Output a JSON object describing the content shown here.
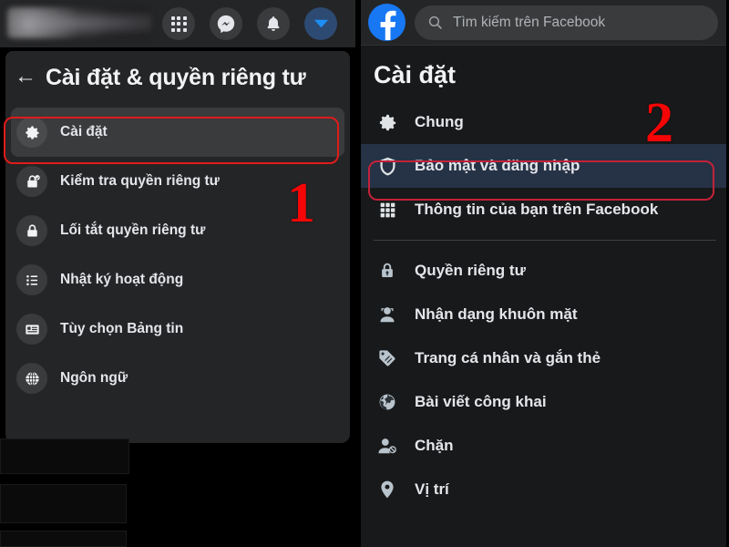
{
  "left_panel": {
    "topbar": {
      "user_name_blurred": "",
      "buttons": [
        {
          "name": "menu-grid",
          "icon": "grid-icon"
        },
        {
          "name": "messenger",
          "icon": "messenger-icon"
        },
        {
          "name": "notifications",
          "icon": "bell-icon"
        },
        {
          "name": "account",
          "icon": "chevron-down-icon"
        }
      ]
    },
    "back_icon": "←",
    "title": "Cài đặt & quyền riêng tư",
    "items": [
      {
        "label": "Cài đặt",
        "icon": "gear-icon",
        "selected": true
      },
      {
        "label": "Kiểm tra quyền riêng tư",
        "icon": "lock-check-icon",
        "selected": false
      },
      {
        "label": "Lối tắt quyền riêng tư",
        "icon": "lock-icon",
        "selected": false
      },
      {
        "label": "Nhật ký hoạt động",
        "icon": "list-icon",
        "selected": false
      },
      {
        "label": "Tùy chọn Bảng tin",
        "icon": "newsfeed-card-icon",
        "selected": false
      },
      {
        "label": "Ngôn ngữ",
        "icon": "globe-icon",
        "selected": false
      }
    ]
  },
  "right_panel": {
    "logo": "f",
    "search": {
      "placeholder": "Tìm kiếm trên Facebook",
      "value": "",
      "icon": "search-icon"
    },
    "title": "Cài đặt",
    "group_one": [
      {
        "label": "Chung",
        "icon": "gear-icon",
        "selected": false
      },
      {
        "label": "Bảo mật và đăng nhập",
        "icon": "shield-icon",
        "selected": true
      },
      {
        "label": "Thông tin của bạn trên Facebook",
        "icon": "grid-icon",
        "selected": false
      }
    ],
    "group_two": [
      {
        "label": "Quyền riêng tư",
        "icon": "privacy-lock-icon",
        "selected": false
      },
      {
        "label": "Nhận dạng khuôn mặt",
        "icon": "face-person-icon",
        "selected": false
      },
      {
        "label": "Trang cá nhân và gắn thẻ",
        "icon": "tag-icon",
        "selected": false
      },
      {
        "label": "Bài viết công khai",
        "icon": "globe-icon",
        "selected": false
      },
      {
        "label": "Chặn",
        "icon": "person-block-icon",
        "selected": false
      },
      {
        "label": "Vị trí",
        "icon": "location-pin-icon",
        "selected": false
      }
    ]
  },
  "annotations": [
    {
      "label": "1",
      "color": "#f50505",
      "target": "Cài đặt"
    },
    {
      "label": "2",
      "color": "#f50505",
      "target": "Bảo mật và đăng nhập"
    }
  ],
  "colors": {
    "facebook_blue": "#1877f2",
    "annotation_red": "#f50505",
    "panel_bg": "#242526",
    "page_bg": "#18191a",
    "selected_blue": "#263245",
    "text_primary": "#e4e6eb",
    "text_secondary": "#b0b3b8"
  }
}
